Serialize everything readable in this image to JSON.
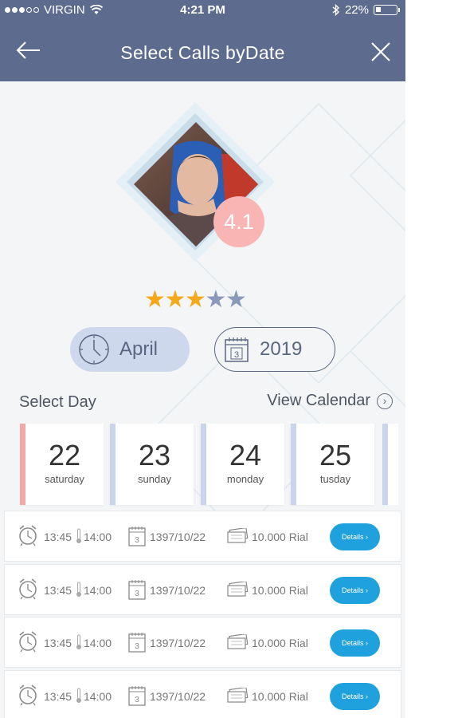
{
  "status_bar": {
    "carrier": "VIRGIN",
    "time": "4:21 PM",
    "battery": "22%",
    "signal_dots_filled": 3,
    "signal_dots_total": 5
  },
  "nav": {
    "title": "Select Calls byDate",
    "back_icon": "arrow-left-icon",
    "close_icon": "close-icon"
  },
  "profile": {
    "rating": "4.1",
    "stars_filled": 3,
    "stars_total": 5
  },
  "filters": {
    "month": "April",
    "year": "2019",
    "month_icon": "clock-icon",
    "year_icon": "calendar-icon"
  },
  "day_section": {
    "label": "Select Day",
    "view_calendar": "View Calendar"
  },
  "days": [
    {
      "num": "22",
      "name": "saturday",
      "selected": true
    },
    {
      "num": "23",
      "name": "sunday",
      "selected": false
    },
    {
      "num": "24",
      "name": "monday",
      "selected": false
    },
    {
      "num": "25",
      "name": "tusday",
      "selected": false
    }
  ],
  "calls": [
    {
      "start": "13:45",
      "end": "14:00",
      "date": "1397/10/22",
      "price": "10.000 Rial",
      "button": "Details ›"
    },
    {
      "start": "13:45",
      "end": "14:00",
      "date": "1397/10/22",
      "price": "10.000 Rial",
      "button": "Details ›"
    },
    {
      "start": "13:45",
      "end": "14:00",
      "date": "1397/10/22",
      "price": "10.000 Rial",
      "button": "Details ›"
    },
    {
      "start": "13:45",
      "end": "14:00",
      "date": "1397/10/22",
      "price": "10.000 Rial",
      "button": "Details ›"
    }
  ],
  "colors": {
    "header": "#5d6b8f",
    "star_on": "#f5a81c",
    "star_off": "#8a99b9",
    "badge": "#f9b5b4",
    "details_button": "#1ea1dc"
  }
}
